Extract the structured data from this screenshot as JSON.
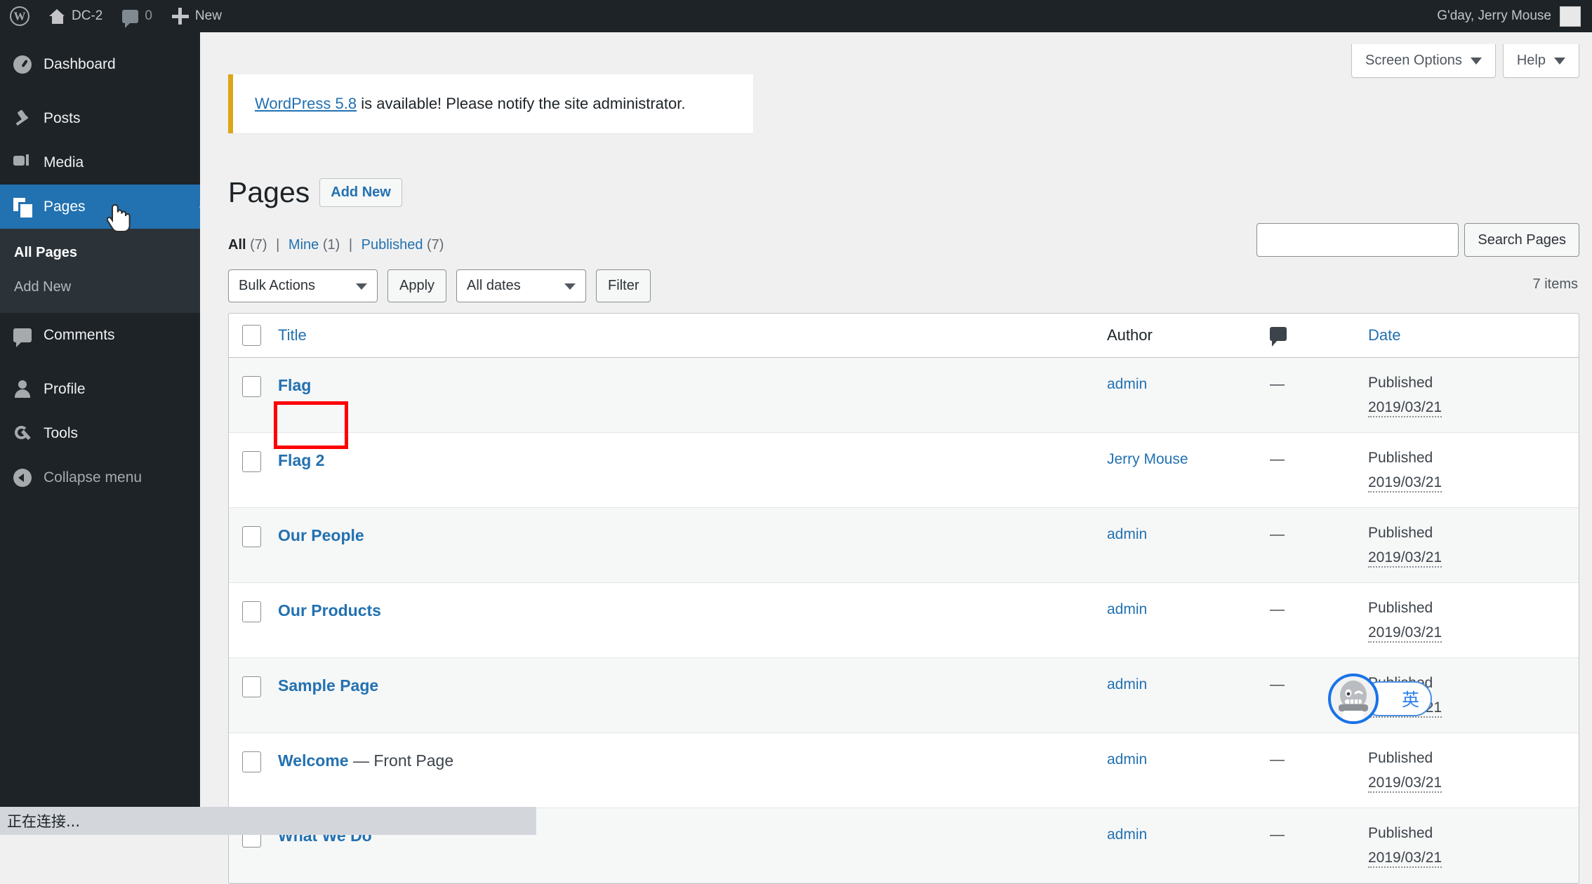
{
  "adminbar": {
    "logo_icon": "wordpress-logo-icon",
    "site_name": "DC-2",
    "home_icon": "home-icon",
    "comments_icon": "comment-bubble-icon",
    "comments_count": "0",
    "plus_icon": "plus-icon",
    "new_label": "New",
    "greeting": "G'day, Jerry Mouse",
    "avatar_icon": "user-avatar"
  },
  "sidebar": {
    "items": [
      {
        "label": "Dashboard",
        "icon": "dashboard-icon",
        "active": false
      },
      {
        "label": "Posts",
        "icon": "pin-icon",
        "active": false
      },
      {
        "label": "Media",
        "icon": "media-icon",
        "active": false
      },
      {
        "label": "Pages",
        "icon": "pages-icon",
        "active": true
      },
      {
        "label": "Comments",
        "icon": "comment-icon",
        "active": false
      },
      {
        "label": "Profile",
        "icon": "user-icon",
        "active": false
      },
      {
        "label": "Tools",
        "icon": "wrench-icon",
        "active": false
      },
      {
        "label": "Collapse menu",
        "icon": "collapse-arrow-icon",
        "active": false
      }
    ],
    "submenu": [
      {
        "label": "All Pages",
        "current": true
      },
      {
        "label": "Add New",
        "current": false
      }
    ]
  },
  "screen_meta": {
    "screen_options_label": "Screen Options",
    "help_label": "Help",
    "caret_icon": "chevron-down-icon"
  },
  "notice": {
    "link_text": "WordPress 5.8",
    "rest_text": " is available! Please notify the site administrator.",
    "accent_color": "#dba617"
  },
  "page": {
    "title": "Pages",
    "add_new_label": "Add New"
  },
  "views": {
    "all_label": "All",
    "all_count": "(7)",
    "mine_label": "Mine",
    "mine_count": "(1)",
    "published_label": "Published",
    "published_count": "(7)",
    "separator": "|"
  },
  "tablenav": {
    "bulk_actions_value": "Bulk Actions",
    "apply_label": "Apply",
    "all_dates_value": "All dates",
    "filter_label": "Filter",
    "item_count": "7 items"
  },
  "search": {
    "value": "",
    "placeholder": "",
    "submit_label": "Search Pages"
  },
  "table": {
    "columns": {
      "title": "Title",
      "author": "Author",
      "comments_icon": "comment-bubble-icon",
      "date": "Date"
    },
    "rows": [
      {
        "title": "Flag",
        "suffix": "",
        "author": "admin",
        "comments": "—",
        "date_state": "Published",
        "date_value": "2019/03/21"
      },
      {
        "title": "Flag 2",
        "suffix": "",
        "author": "Jerry Mouse",
        "comments": "—",
        "date_state": "Published",
        "date_value": "2019/03/21"
      },
      {
        "title": "Our People",
        "suffix": "",
        "author": "admin",
        "comments": "—",
        "date_state": "Published",
        "date_value": "2019/03/21"
      },
      {
        "title": "Our Products",
        "suffix": "",
        "author": "admin",
        "comments": "—",
        "date_state": "Published",
        "date_value": "2019/03/21"
      },
      {
        "title": "Sample Page",
        "suffix": "",
        "author": "admin",
        "comments": "—",
        "date_state": "Published",
        "date_value": "2019/03/21"
      },
      {
        "title": "Welcome",
        "suffix": " — Front Page",
        "author": "admin",
        "comments": "—",
        "date_state": "Published",
        "date_value": "2019/03/21"
      },
      {
        "title": "What We Do",
        "suffix": "",
        "author": "admin",
        "comments": "—",
        "date_state": "Published",
        "date_value": "2019/03/21"
      }
    ]
  },
  "annotation": {
    "target": "Flag 2",
    "color": "#ff0000"
  },
  "ime": {
    "mode_label": "英",
    "avatar_icon": "sogou-robot-avatar",
    "accent_color": "#1a73e8"
  },
  "statusbar": {
    "text": "正在连接..."
  },
  "cursor": {
    "icon": "pointing-hand-cursor"
  }
}
